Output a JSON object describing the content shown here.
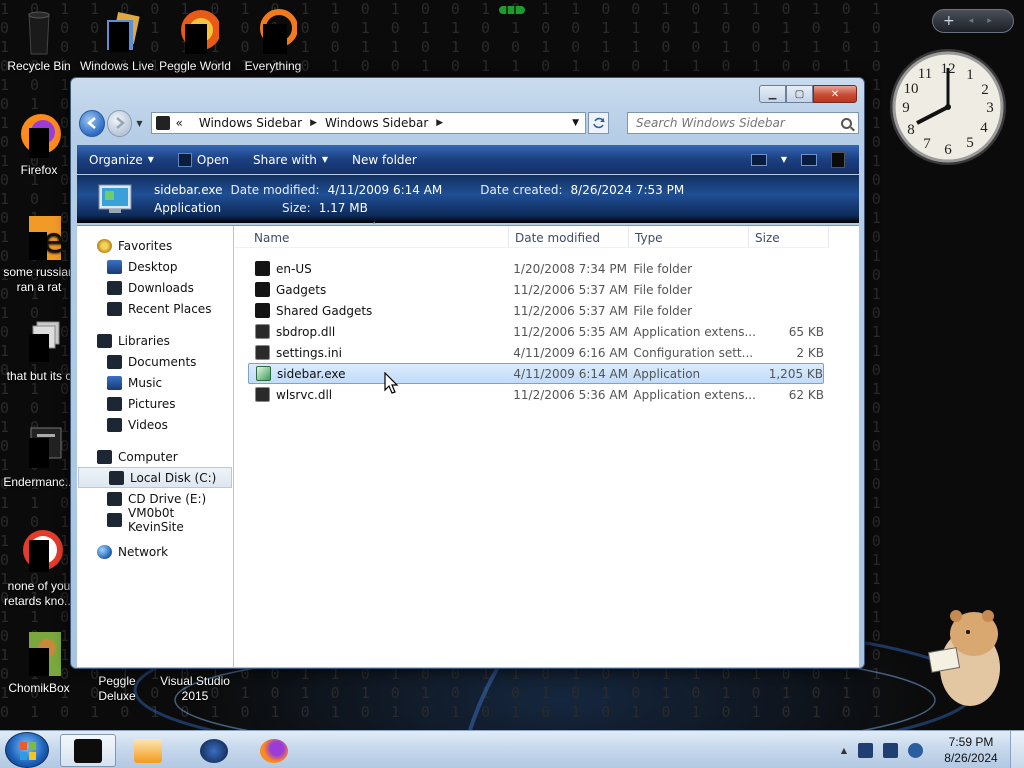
{
  "desktop": {
    "icons": [
      {
        "label": "Recycle Bin"
      },
      {
        "label": "Windows Live"
      },
      {
        "label": "Peggle World"
      },
      {
        "label": "Everything"
      },
      {
        "label": "Firefox"
      },
      {
        "label": "some russian ran a rat"
      },
      {
        "label": "that but its c"
      },
      {
        "label": "Endermanc..."
      },
      {
        "label": "none of you retards kno..."
      },
      {
        "label": "ChomikBox"
      },
      {
        "label": "Peggle Deluxe"
      },
      {
        "label": "Visual Studio 2015"
      }
    ]
  },
  "window": {
    "caption": {
      "minimize": "▁",
      "maximize": "▢",
      "close": "✕"
    },
    "address": {
      "prefix": "«",
      "crumbs": [
        "Windows Sidebar",
        "Windows Sidebar"
      ]
    },
    "search": {
      "placeholder": "Search Windows Sidebar"
    },
    "toolbar": {
      "organize": "Organize",
      "open": "Open",
      "share_with": "Share with",
      "new_folder": "New folder"
    },
    "details": {
      "filename": "sidebar.exe",
      "modified_label": "Date modified:",
      "modified": "4/11/2009 6:14 AM",
      "created_label": "Date created:",
      "created": "8/26/2024 7:53 PM",
      "type": "Application",
      "size_label": "Size:",
      "size": "1.17 MB"
    },
    "nav": {
      "favorites": {
        "label": "Favorites",
        "items": [
          "Desktop",
          "Downloads",
          "Recent Places"
        ]
      },
      "libraries": {
        "label": "Libraries",
        "items": [
          "Documents",
          "Music",
          "Pictures",
          "Videos"
        ]
      },
      "computer": {
        "label": "Computer",
        "items": [
          "Local Disk (C:)",
          "CD Drive (E:)",
          "VM0b0t KevinSite"
        ]
      },
      "network": {
        "label": "Network"
      }
    },
    "columns": {
      "name": "Name",
      "date": "Date modified",
      "type": "Type",
      "size": "Size"
    },
    "files": [
      {
        "name": "en-US",
        "date": "1/20/2008 7:34 PM",
        "type": "File folder",
        "size": ""
      },
      {
        "name": "Gadgets",
        "date": "11/2/2006 5:37 AM",
        "type": "File folder",
        "size": ""
      },
      {
        "name": "Shared Gadgets",
        "date": "11/2/2006 5:37 AM",
        "type": "File folder",
        "size": ""
      },
      {
        "name": "sbdrop.dll",
        "date": "11/2/2006 5:35 AM",
        "type": "Application extens...",
        "size": "65 KB"
      },
      {
        "name": "settings.ini",
        "date": "4/11/2009 6:16 AM",
        "type": "Configuration sett...",
        "size": "2 KB"
      },
      {
        "name": "sidebar.exe",
        "date": "4/11/2009 6:14 AM",
        "type": "Application",
        "size": "1,205 KB"
      },
      {
        "name": "wlsrvc.dll",
        "date": "11/2/2006 5:36 AM",
        "type": "Application extens...",
        "size": "62 KB"
      }
    ]
  },
  "gadget": {
    "controls": {
      "add": "+",
      "prev": "◂",
      "next": "▸"
    }
  },
  "taskbar": {
    "time": "7:59 PM",
    "date": "8/26/2024",
    "tray_arrow": "▲"
  }
}
